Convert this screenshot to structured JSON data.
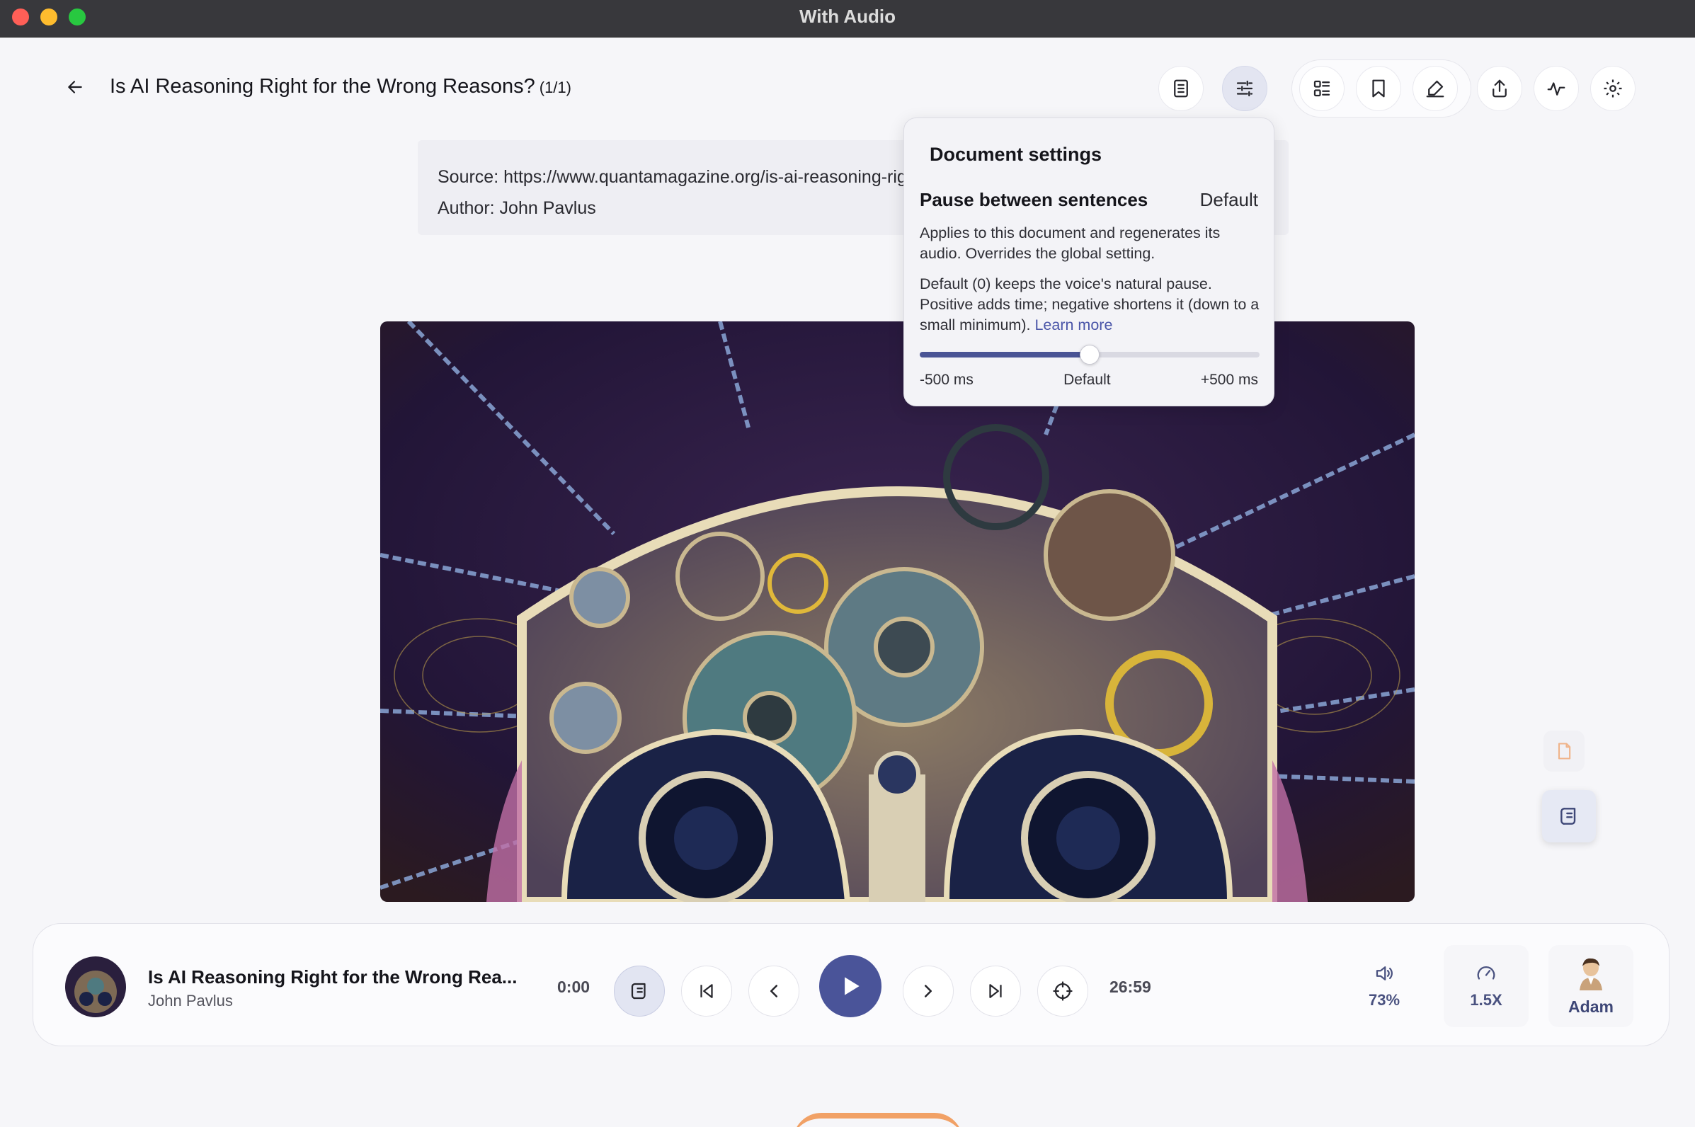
{
  "window": {
    "title": "With Audio"
  },
  "header": {
    "title": "Is AI Reasoning Right for the Wrong Reasons?",
    "count": "(1/1)"
  },
  "toolbar": {
    "icons": [
      "document-icon",
      "sliders-icon",
      "outline-icon",
      "bookmark-icon",
      "highlight-icon",
      "share-icon",
      "waveform-icon",
      "gear-icon"
    ]
  },
  "source": {
    "source_line": "Source: https://www.quantamagazine.org/is-ai-reasoning-right-for-the-wrong-reasons-20260731/",
    "author_line": "Author: John Pavlus"
  },
  "popover": {
    "title": "Document settings",
    "setting_label": "Pause between sentences",
    "setting_value": "Default",
    "description_1": "Applies to this document and regenerates its audio. Overrides the global setting.",
    "description_2": "Default (0) keeps the voice's natural pause. Positive adds time; negative shortens it (down to a small minimum).",
    "learn_more": "Learn more",
    "slider": {
      "min_label": "-500 ms",
      "mid_label": "Default",
      "max_label": "+500 ms",
      "min": -500,
      "max": 500,
      "value": 0
    }
  },
  "player": {
    "title": "Is AI Reasoning Right for the Wrong Rea...",
    "author": "John Pavlus",
    "elapsed": "0:00",
    "duration": "26:59",
    "volume": "73%",
    "speed": "1.5X",
    "voice": "Adam"
  },
  "colors": {
    "accent": "#4a5499",
    "titlebar": "#38383c",
    "background": "#f6f6f9"
  }
}
